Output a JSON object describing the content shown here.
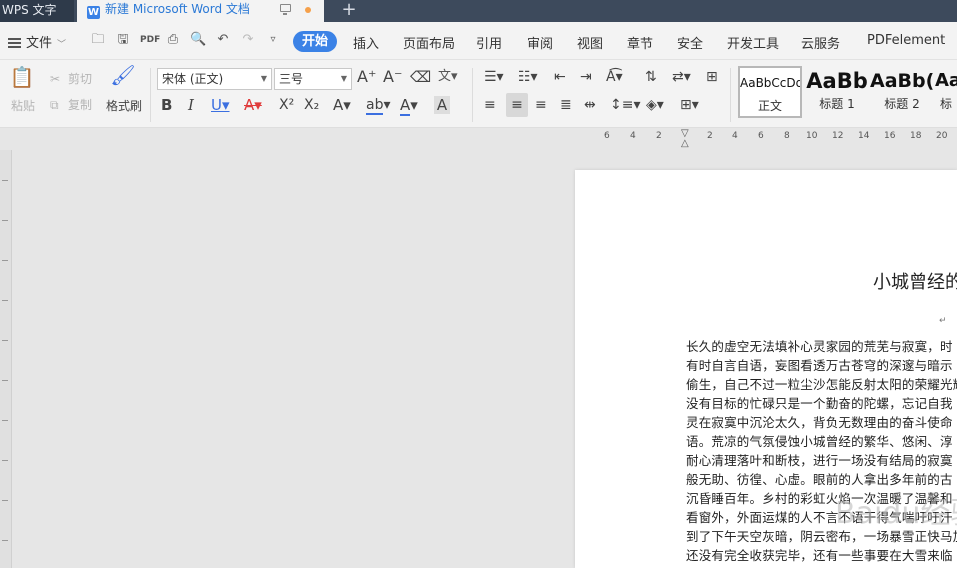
{
  "titlebar": {
    "app_tab": "WPS 文字",
    "doc_tab": "新建 Microsoft Word 文档",
    "new_tab_symbol": "+"
  },
  "menubar": {
    "file_label": "文件",
    "items": [
      "开始",
      "插入",
      "页面布局",
      "引用",
      "审阅",
      "视图",
      "章节",
      "安全",
      "开发工具",
      "云服务",
      "PDFelement"
    ],
    "active_index": 0
  },
  "ribbon": {
    "paste_label": "粘贴",
    "cut_label": "剪切",
    "copy_label": "复制",
    "format_painter_label": "格式刷",
    "font_name": "宋体 (正文)",
    "font_size": "三号",
    "styles": [
      {
        "preview": "AaBbCcDd",
        "label": "正文"
      },
      {
        "preview": "AaBb",
        "label": "标题 1"
      },
      {
        "preview": "AaBb(",
        "label": "标题 2"
      },
      {
        "preview": "Aa",
        "label": "标"
      }
    ]
  },
  "ruler": {
    "h_ticks": [
      "6",
      "4",
      "2",
      "2",
      "4",
      "6",
      "8",
      "10",
      "12",
      "14",
      "16",
      "18",
      "20"
    ]
  },
  "document": {
    "title": "小城曾经的",
    "lines": [
      "长久的虚空无法填补心灵家园的荒芜与寂寞，时",
      "有时自言自语，妄图看透万古苍穹的深邃与暗示",
      "偷生，自己不过一粒尘沙怎能反射太阳的荣耀光辉",
      "没有目标的忙碌只是一个勤奋的陀螺，忘记自我",
      "灵在寂寞中沉沦太久，背负无数理由的奋斗使命",
      "语。荒凉的气氛侵蚀小城曾经的繁华、悠闲、淳",
      "耐心清理落叶和断枝，进行一场没有结局的寂寞",
      "般无助、彷徨、心虚。眼前的人拿出多年前的古",
      "沉昏睡百年。乡村的彩虹火焰一次温暖了温馨和",
      "看窗外，外面运煤的人不言不语干得气喘吁吁汗",
      "到了下午天空灰暗，阴云密布，一场暴雪正快马加鞭",
      "还没有完全收获完毕，还有一些事要在大雪来临"
    ],
    "watermark": "Baidu经验"
  }
}
